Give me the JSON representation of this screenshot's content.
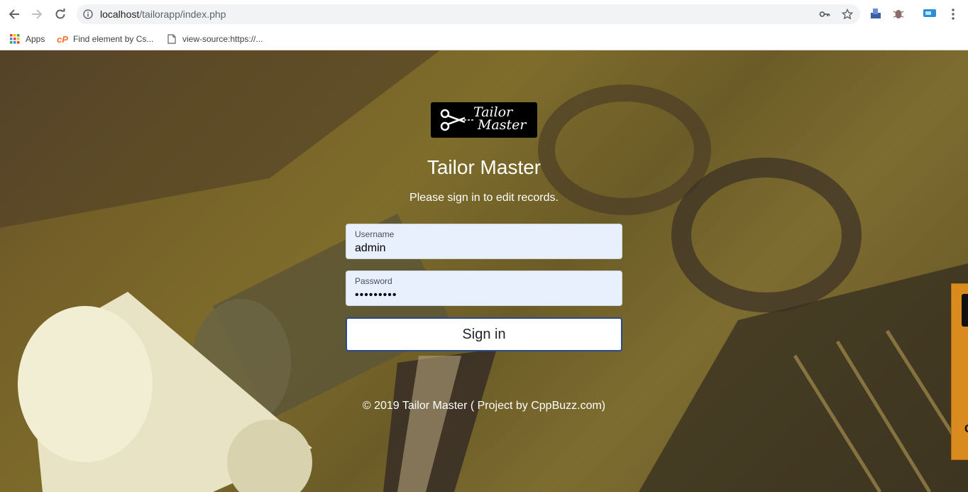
{
  "browser": {
    "url_host": "localhost",
    "url_path": "/tailorapp/index.php",
    "bookmarks": [
      {
        "label": "Apps",
        "icon": "apps-grid-icon"
      },
      {
        "label": "Find element by Cs...",
        "icon": "cpanel-icon"
      },
      {
        "label": "view-source:https://...",
        "icon": "page-icon"
      }
    ]
  },
  "login": {
    "logo_line1": "Tailor",
    "logo_line2": "Master",
    "title": "Tailor Master",
    "subtitle": "Please sign in to edit records.",
    "username_label": "Username",
    "username_value": "admin",
    "password_label": "Password",
    "password_value": "•••••••••",
    "signin_label": "Sign in",
    "footer": "© 2019 Tailor Master ( Project by CppBuzz.com)"
  },
  "side_widget": {
    "text": "C"
  },
  "colors": {
    "field_bg": "#e8f0fe",
    "button_border": "#2a4a8a",
    "widget_orange": "#d98b1e"
  }
}
